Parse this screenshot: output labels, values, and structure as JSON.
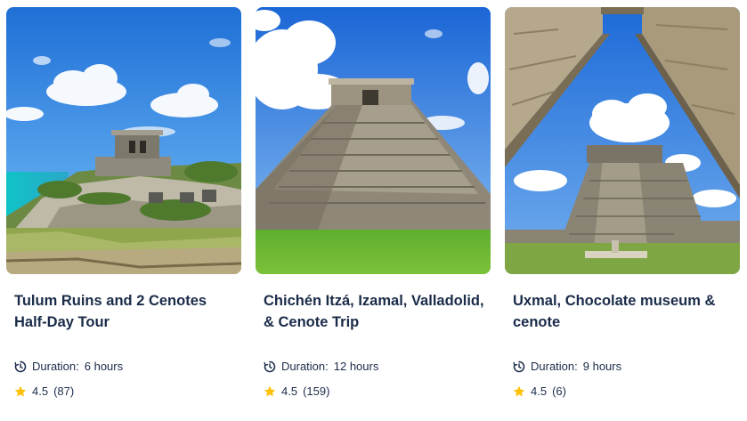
{
  "colors": {
    "text": "#1a2b49",
    "star": "#ffc107"
  },
  "icons": {
    "duration": "clock-arrow-icon",
    "rating": "star-icon"
  },
  "tours": [
    {
      "title": "Tulum Ruins and 2 Cenotes Half-Day Tour",
      "duration_label": "Duration:",
      "duration_value": "6 hours",
      "rating": "4.5",
      "reviews": "(87)"
    },
    {
      "title": "Chichén Itzá, Izamal, Valladolid, & Cenote Trip",
      "duration_label": "Duration:",
      "duration_value": "12 hours",
      "rating": "4.5",
      "reviews": "(159)"
    },
    {
      "title": "Uxmal, Chocolate museum & cenote",
      "duration_label": "Duration:",
      "duration_value": "9 hours",
      "rating": "4.5",
      "reviews": "(6)"
    }
  ]
}
